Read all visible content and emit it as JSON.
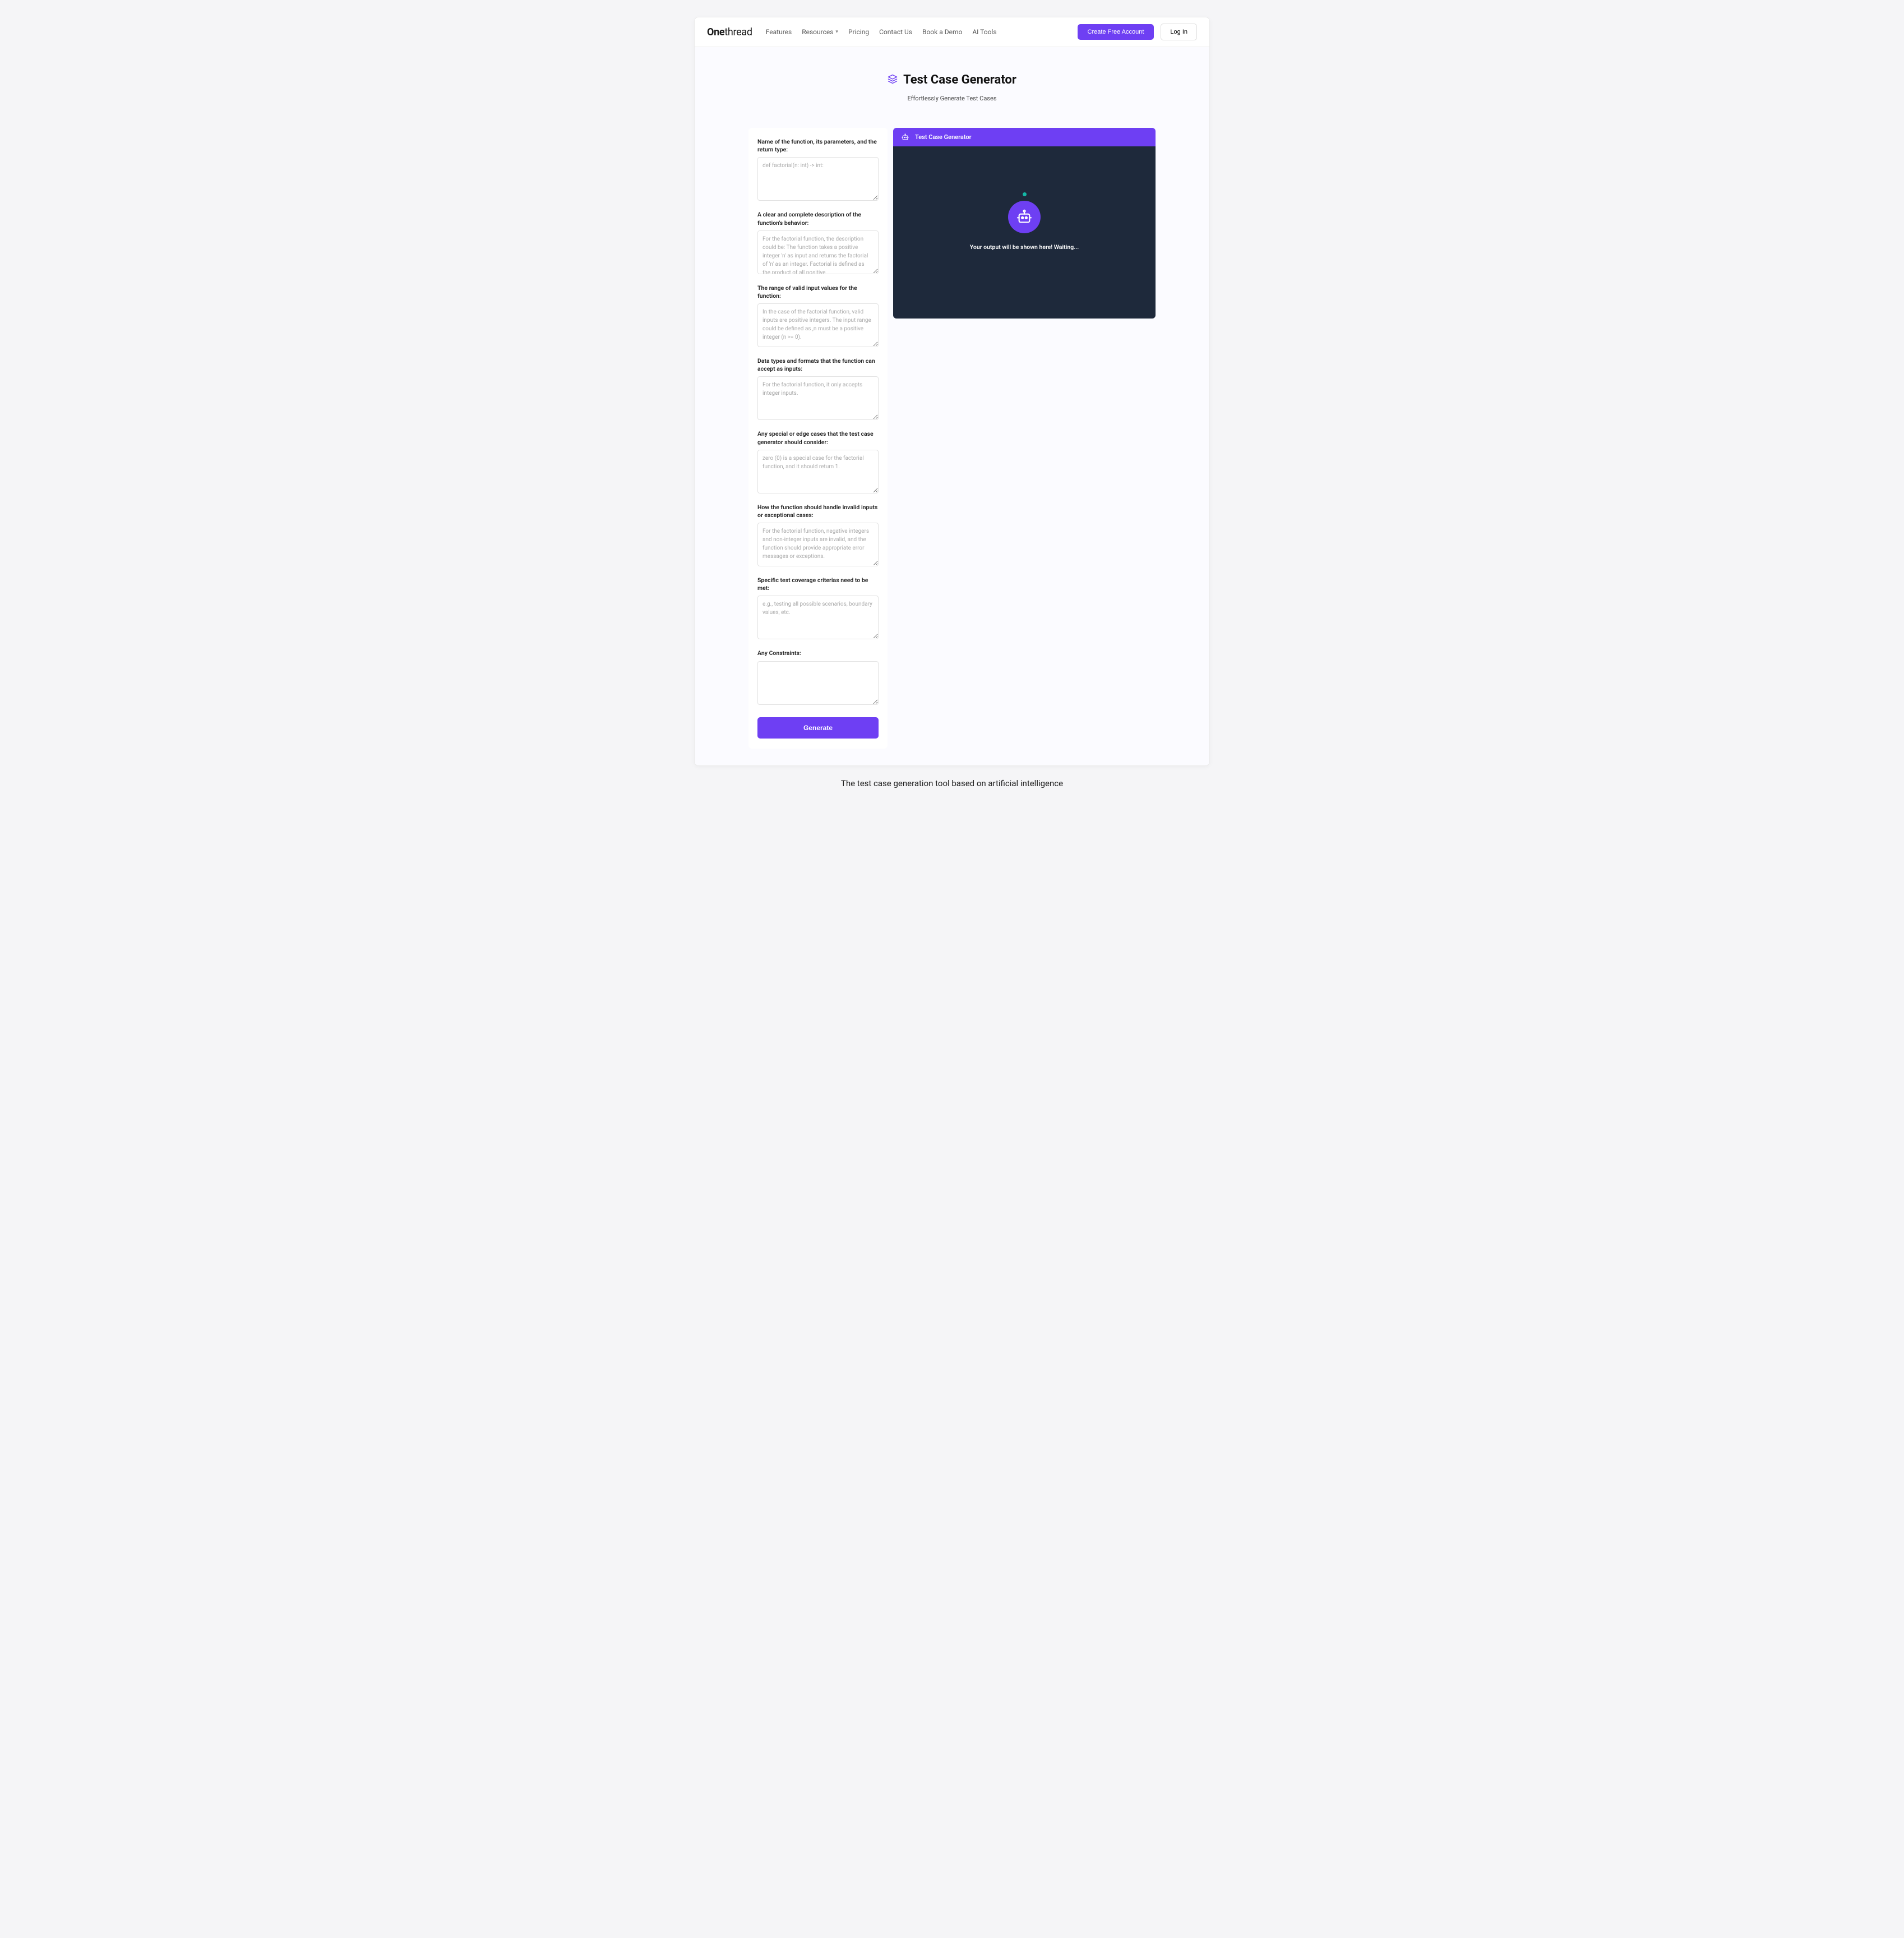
{
  "brand": {
    "one": "One",
    "thread": "thread"
  },
  "nav": {
    "features": "Features",
    "resources": "Resources",
    "pricing": "Pricing",
    "contact": "Contact Us",
    "demo": "Book a Demo",
    "ai_tools": "AI Tools"
  },
  "cta": {
    "create": "Create Free Account",
    "login": "Log In"
  },
  "hero": {
    "title": "Test Case Generator",
    "subtitle": "Effortlessly Generate Test Cases"
  },
  "form": {
    "fields": [
      {
        "label": "Name of the function, its parameters, and the return type:",
        "placeholder": "def factorial(n: int) -> int:",
        "scroll": false
      },
      {
        "label": "A clear and complete description of the function's behavior:",
        "placeholder": "For the factorial function, the description could be: The function takes a positive integer 'n' as input and returns the factorial of 'n' as an integer. Factorial is defined as the product of all positive",
        "scroll": true
      },
      {
        "label": "The range of valid input values for the function:",
        "placeholder": "In the case of the factorial function, valid inputs are positive integers. The input range could be defined as ,n must be a positive integer (n >= 0).",
        "scroll": false
      },
      {
        "label": "Data types and formats that the function can accept as inputs:",
        "placeholder": "For the factorial function, it only accepts integer inputs.",
        "scroll": false
      },
      {
        "label": "Any special or edge cases that the test case generator should consider:",
        "placeholder": "zero (0) is a special case for the factorial function, and it should return 1.",
        "scroll": false
      },
      {
        "label": "How the function should handle invalid inputs or exceptional cases:",
        "placeholder": "For the factorial function, negative integers and non-integer inputs are invalid, and the function should provide appropriate error messages or exceptions.",
        "scroll": false
      },
      {
        "label": "Specific test coverage criterias need to be met:",
        "placeholder": "e.g., testing all possible scenarios, boundary values, etc.",
        "scroll": false
      },
      {
        "label": "Any Constraints:",
        "placeholder": "",
        "scroll": false
      }
    ],
    "generate": "Generate"
  },
  "output": {
    "header": "Test Case Generator",
    "message": "Your output will be shown here! Waiting..."
  },
  "caption": "The test case generation tool based on artificial intelligence"
}
